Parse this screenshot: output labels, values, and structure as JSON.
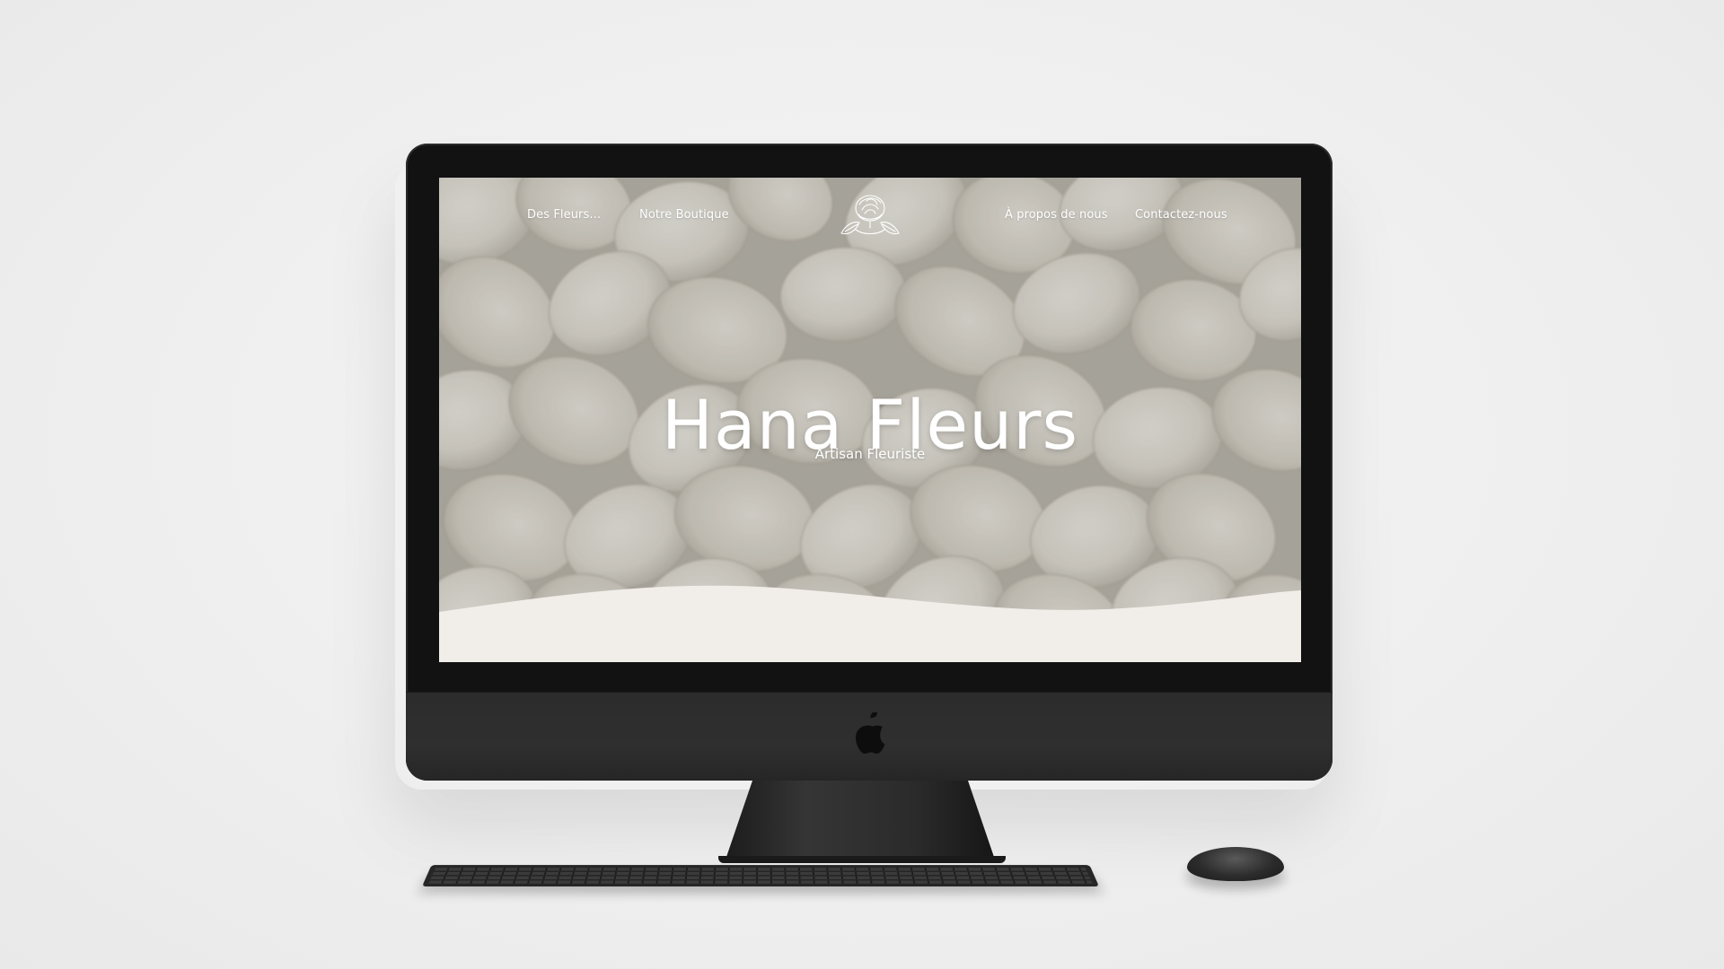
{
  "website": {
    "nav": {
      "left_items": [
        "Des Fleurs...",
        "Notre Boutique"
      ],
      "right_items": [
        "À propos de nous",
        "Contactez-nous"
      ],
      "logo_icon": "rose-logo-icon"
    },
    "hero": {
      "title": "Hana Fleurs",
      "subtitle": "Artisan Fleuriste"
    }
  },
  "device": {
    "brand_icon": "apple-logo-icon"
  },
  "colors": {
    "page_background": "#efefef",
    "monitor_bezel": "#121212",
    "monitor_chin": "#2c2c2c",
    "hero_text": "#ffffff",
    "wave_fill": "#f1eeea",
    "petal_base": "#e9e5dd"
  }
}
